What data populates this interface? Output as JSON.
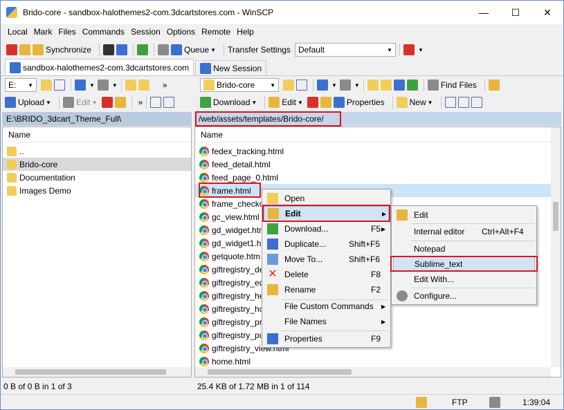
{
  "window": {
    "title": "Brido-core - sandbox-halothemes2-com.3dcartstores.com - WinSCP",
    "controls": {
      "minimize": "—",
      "maximize": "☐",
      "close": "✕"
    }
  },
  "menubar": [
    "Local",
    "Mark",
    "Files",
    "Commands",
    "Session",
    "Options",
    "Remote",
    "Help"
  ],
  "toolbar1": {
    "synchronize": "Synchronize",
    "queue": "Queue",
    "transfer_settings_label": "Transfer Settings",
    "transfer_settings_value": "Default"
  },
  "tabs": [
    {
      "label": "sandbox-halothemes2-com.3dcartstores.com"
    },
    {
      "label": "New Session"
    }
  ],
  "left_panel": {
    "drive": "E:",
    "upload": "Upload",
    "edit": "Edit",
    "path": "E:\\BRIDO_3dcart_Theme_Full\\",
    "column_name": "Name",
    "items": [
      {
        "name": "..",
        "type": "up"
      },
      {
        "name": "Brido-core",
        "type": "folder"
      },
      {
        "name": "Documentation",
        "type": "folder"
      },
      {
        "name": "Images Demo",
        "type": "folder"
      }
    ],
    "status": "0 B of 0 B in 1 of 3"
  },
  "right_panel": {
    "folder": "Brido-core",
    "find_files": "Find Files",
    "download": "Download",
    "edit": "Edit",
    "properties": "Properties",
    "new": "New",
    "path": "/web/assets/templates/Brido-core/",
    "column_name": "Name",
    "items": [
      "fedex_tracking.html",
      "feed_detail.html",
      "feed_page_0.html",
      "frame.html",
      "frame_checko",
      "gc_view.html",
      "gd_widget.htm",
      "gd_widget1.h",
      "getquote.htm",
      "giftregistry_de",
      "giftregistry_ed",
      "giftregistry_he",
      "giftregistry_ho",
      "giftregistry_pr",
      "giftregistry_pu",
      "giftregistry_view.html",
      "home.html"
    ],
    "status": "25.4 KB of 1.72 MB in 1 of 114"
  },
  "bottom_bar": {
    "protocol": "FTP",
    "time": "1:39:04"
  },
  "context_menu": [
    {
      "label": "Open",
      "shortcut": ""
    },
    {
      "label": "Edit",
      "shortcut": ""
    },
    {
      "label": "Download...",
      "shortcut": "F5"
    },
    {
      "label": "Duplicate...",
      "shortcut": "Shift+F5"
    },
    {
      "label": "Move To...",
      "shortcut": "Shift+F6"
    },
    {
      "label": "Delete",
      "shortcut": "F8"
    },
    {
      "label": "Rename",
      "shortcut": "F2"
    },
    {
      "label": "File Custom Commands",
      "shortcut": ""
    },
    {
      "label": "File Names",
      "shortcut": ""
    },
    {
      "label": "Properties",
      "shortcut": "F9"
    }
  ],
  "submenu": [
    {
      "label": "Edit",
      "shortcut": ""
    },
    {
      "label": "Internal editor",
      "shortcut": "Ctrl+Alt+F4"
    },
    {
      "label": "Notepad",
      "shortcut": ""
    },
    {
      "label": "Sublime_text",
      "shortcut": ""
    },
    {
      "label": "Edit With...",
      "shortcut": ""
    },
    {
      "label": "Configure...",
      "shortcut": ""
    }
  ]
}
